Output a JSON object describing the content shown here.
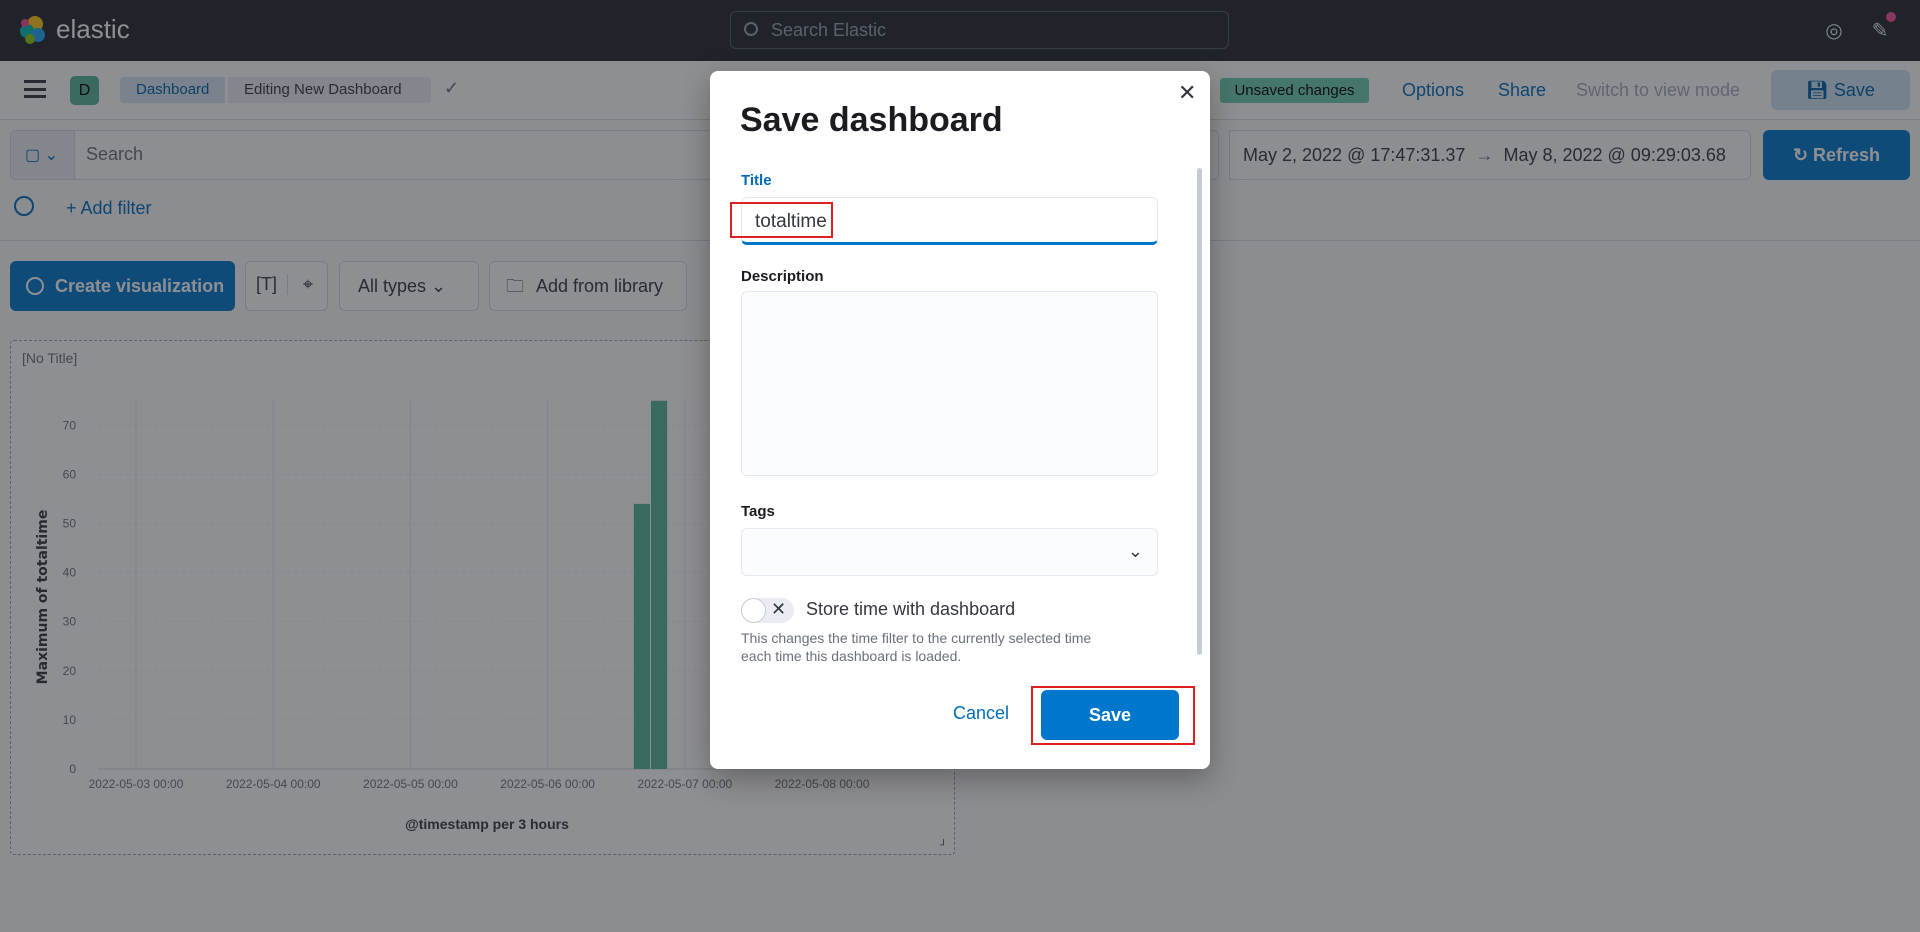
{
  "header": {
    "brand": "elastic",
    "search_placeholder": "Search Elastic"
  },
  "subbar": {
    "space_initial": "D",
    "breadcrumbs": [
      "Dashboard",
      "Editing New Dashboard"
    ],
    "unsaved": "Unsaved changes",
    "options": "Options",
    "share": "Share",
    "switch_mode": "Switch to view mode",
    "save": "Save"
  },
  "query": {
    "placeholder": "Search",
    "date_start": "May 2, 2022 @ 17:47:31.37",
    "arrow": "→",
    "date_end": "May 8, 2022 @ 09:29:03.68",
    "refresh": "Refresh",
    "add_filter": "+ Add filter"
  },
  "toolbar": {
    "create_viz": "Create visualization",
    "all_types": "All types",
    "add_library": "Add from library"
  },
  "panel": {
    "title": "[No Title]"
  },
  "chart_data": {
    "type": "bar",
    "xlabel": "@timestamp per 3 hours",
    "ylabel": "Maximum of totaltime",
    "x_ticks": [
      "2022-05-03 00:00",
      "2022-05-04 00:00",
      "2022-05-05 00:00",
      "2022-05-06 00:00",
      "2022-05-07 00:00",
      "2022-05-08 00:00"
    ],
    "y_ticks": [
      0,
      10,
      20,
      30,
      40,
      50,
      60,
      70
    ],
    "ylim": [
      0,
      75
    ],
    "grid": true,
    "color": "#54b399",
    "points": [
      {
        "x": "2022-05-06 15:00",
        "y": 54
      },
      {
        "x": "2022-05-06 18:00",
        "y": 75
      }
    ]
  },
  "modal": {
    "title": "Save dashboard",
    "title_label": "Title",
    "title_value": "totaltime",
    "description_label": "Description",
    "description_value": "",
    "tags_label": "Tags",
    "store_time_label": "Store time with dashboard",
    "store_time_on": false,
    "help_line1": "This changes the time filter to the currently selected time",
    "help_line2": "each time this dashboard is loaded.",
    "cancel": "Cancel",
    "save": "Save"
  }
}
